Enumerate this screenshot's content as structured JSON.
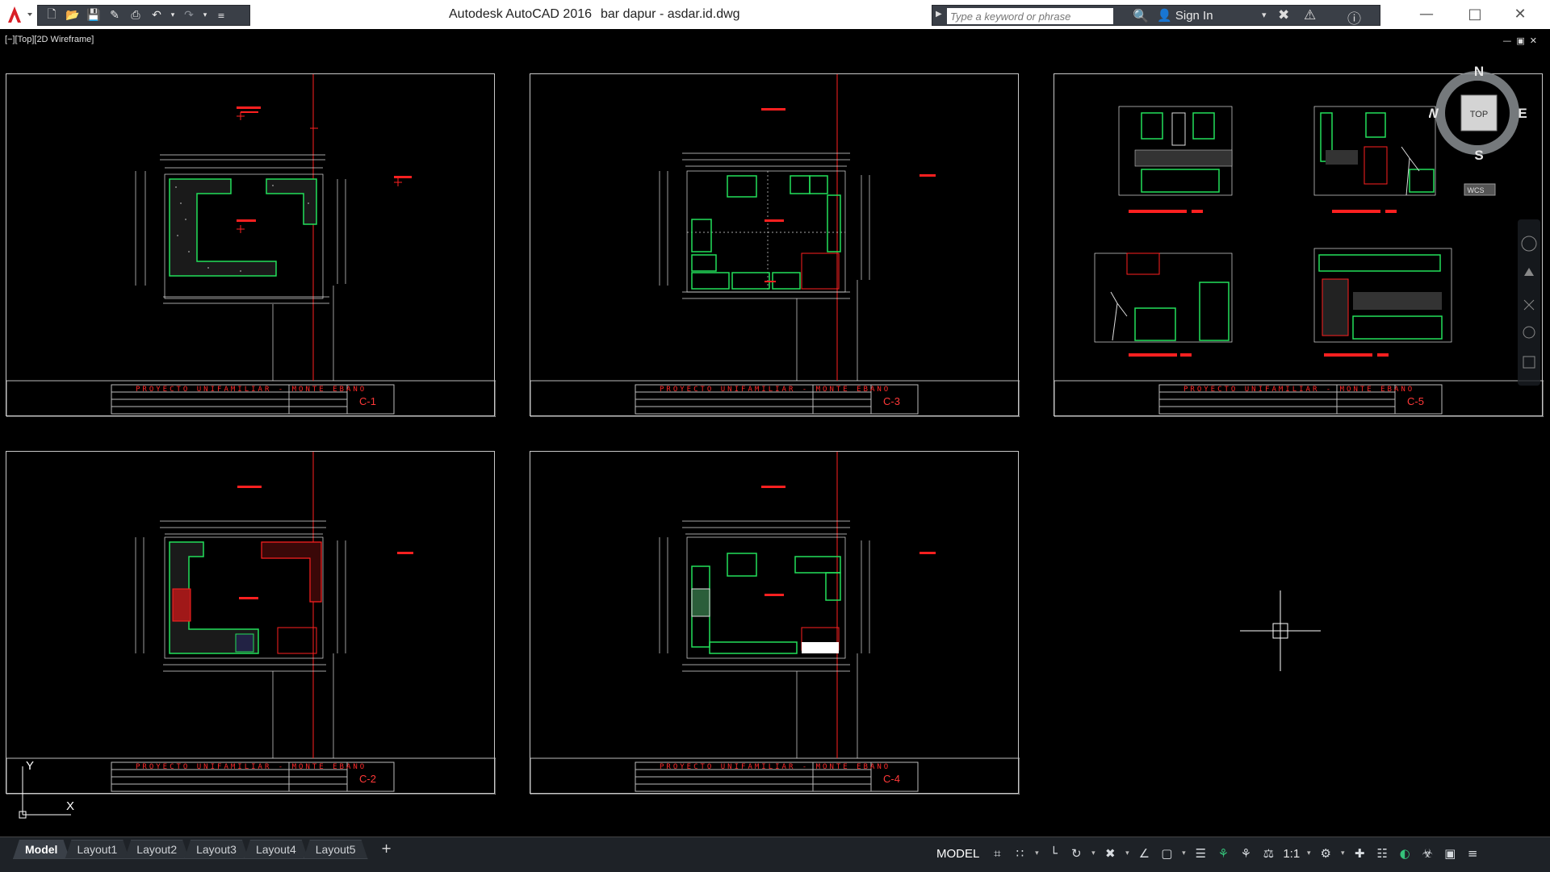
{
  "titlebar": {
    "app_title": "Autodesk AutoCAD 2016",
    "file_name": "bar dapur - asdar.id.dwg",
    "search_placeholder": "Type a keyword or phrase",
    "sign_in": "Sign In"
  },
  "viewport": {
    "label": "[−][Top][2D Wireframe]"
  },
  "viewcube": {
    "top": "TOP",
    "north": "N",
    "south": "S",
    "east": "E",
    "west": "W",
    "ucs": "WCS"
  },
  "ucs_icon": {
    "y": "Y",
    "x": "X"
  },
  "sheets": [
    {
      "title": "PROYECTO UNIFAMILIAR - MONTE EBANO",
      "number": "C-1"
    },
    {
      "title": "PROYECTO UNIFAMILIAR - MONTE EBANO",
      "number": "C-3"
    },
    {
      "title": "PROYECTO UNIFAMILIAR - MONTE EBANO",
      "number": "C-5"
    },
    {
      "title": "PROYECTO UNIFAMILIAR - MONTE EBANO",
      "number": "C-2"
    },
    {
      "title": "PROYECTO UNIFAMILIAR - MONTE EBANO",
      "number": "C-4"
    }
  ],
  "tabs": [
    {
      "label": "Model",
      "active": true
    },
    {
      "label": "Layout1",
      "active": false
    },
    {
      "label": "Layout2",
      "active": false
    },
    {
      "label": "Layout3",
      "active": false
    },
    {
      "label": "Layout4",
      "active": false
    },
    {
      "label": "Layout5",
      "active": false
    }
  ],
  "status": {
    "model": "MODEL",
    "annotation_scale": "1:1"
  },
  "colors": {
    "canvas": "#000000",
    "drawing_red": "#ff2020",
    "drawing_green": "#22e05a",
    "dims_white": "#d8d8d8"
  }
}
